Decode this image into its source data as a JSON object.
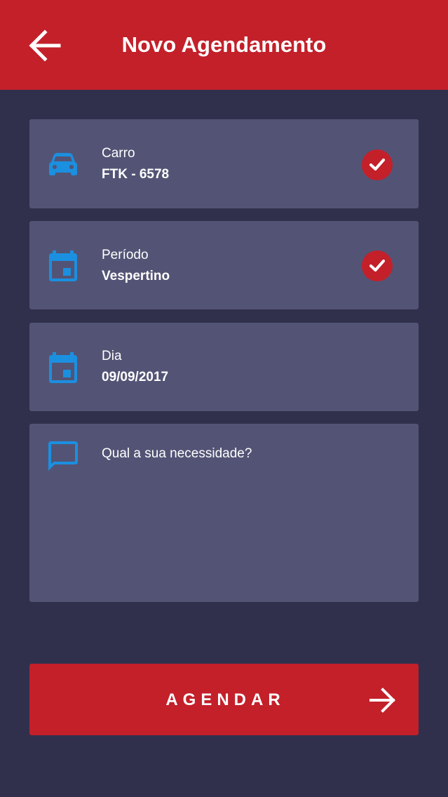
{
  "colors": {
    "background": "#30304d",
    "header": "#c3202a",
    "card": "#535475",
    "icon_accent": "#1b8fe0",
    "check_badge": "#c3202a",
    "button": "#c3202a"
  },
  "header": {
    "back_icon": "arrow-left-icon",
    "title": "Novo Agendamento"
  },
  "form": {
    "car": {
      "icon": "car-icon",
      "label": "Carro",
      "value": "FTK - 6578",
      "status_icon": "check-icon"
    },
    "period": {
      "icon": "calendar-icon",
      "label": "Período",
      "value": "Vespertino",
      "status_icon": "check-icon"
    },
    "day": {
      "icon": "calendar-icon",
      "label": "Dia",
      "value": "09/09/2017"
    },
    "need": {
      "icon": "comment-icon",
      "placeholder": "Qual a sua necessidade?"
    }
  },
  "submit": {
    "label": "AGENDAR",
    "icon": "arrow-right-icon"
  }
}
